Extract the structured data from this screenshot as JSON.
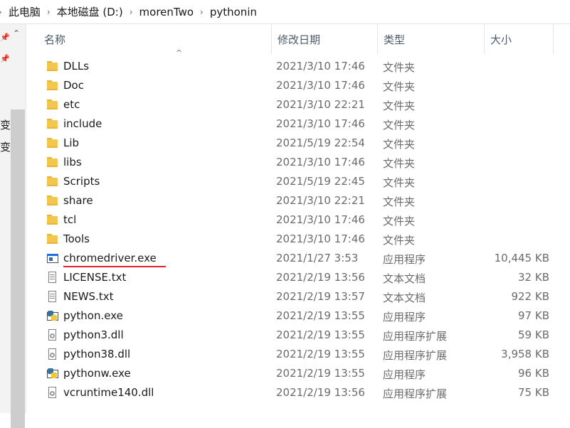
{
  "breadcrumb": [
    "此电脑",
    "本地磁盘 (D:)",
    "morenTwo",
    "pythonin"
  ],
  "nav": {
    "cut_labels": [
      "变",
      "变"
    ]
  },
  "columns": {
    "name": "名称",
    "date": "修改日期",
    "type": "类型",
    "size": "大小"
  },
  "files": [
    {
      "name": "DLLs",
      "date": "2021/3/10 17:46",
      "type": "文件夹",
      "size": "",
      "icon": "folder-icon"
    },
    {
      "name": "Doc",
      "date": "2021/3/10 17:46",
      "type": "文件夹",
      "size": "",
      "icon": "folder-icon"
    },
    {
      "name": "etc",
      "date": "2021/3/10 22:21",
      "type": "文件夹",
      "size": "",
      "icon": "folder-icon"
    },
    {
      "name": "include",
      "date": "2021/3/10 17:46",
      "type": "文件夹",
      "size": "",
      "icon": "folder-icon"
    },
    {
      "name": "Lib",
      "date": "2021/5/19 22:54",
      "type": "文件夹",
      "size": "",
      "icon": "folder-icon"
    },
    {
      "name": "libs",
      "date": "2021/3/10 17:46",
      "type": "文件夹",
      "size": "",
      "icon": "folder-icon"
    },
    {
      "name": "Scripts",
      "date": "2021/5/19 22:45",
      "type": "文件夹",
      "size": "",
      "icon": "folder-icon"
    },
    {
      "name": "share",
      "date": "2021/3/10 22:21",
      "type": "文件夹",
      "size": "",
      "icon": "folder-icon"
    },
    {
      "name": "tcl",
      "date": "2021/3/10 17:46",
      "type": "文件夹",
      "size": "",
      "icon": "folder-icon"
    },
    {
      "name": "Tools",
      "date": "2021/3/10 17:46",
      "type": "文件夹",
      "size": "",
      "icon": "folder-icon"
    },
    {
      "name": "chromedriver.exe",
      "date": "2021/1/27 3:53",
      "type": "应用程序",
      "size": "10,445 KB",
      "icon": "app-exe-icon",
      "underlined": true
    },
    {
      "name": "LICENSE.txt",
      "date": "2021/2/19 13:56",
      "type": "文本文档",
      "size": "32 KB",
      "icon": "text-file-icon"
    },
    {
      "name": "NEWS.txt",
      "date": "2021/2/19 13:57",
      "type": "文本文档",
      "size": "922 KB",
      "icon": "text-file-icon"
    },
    {
      "name": "python.exe",
      "date": "2021/2/19 13:55",
      "type": "应用程序",
      "size": "97 KB",
      "icon": "python-exe-icon"
    },
    {
      "name": "python3.dll",
      "date": "2021/2/19 13:55",
      "type": "应用程序扩展",
      "size": "59 KB",
      "icon": "dll-icon"
    },
    {
      "name": "python38.dll",
      "date": "2021/2/19 13:55",
      "type": "应用程序扩展",
      "size": "3,958 KB",
      "icon": "dll-icon"
    },
    {
      "name": "pythonw.exe",
      "date": "2021/2/19 13:55",
      "type": "应用程序",
      "size": "96 KB",
      "icon": "python-exe-icon"
    },
    {
      "name": "vcruntime140.dll",
      "date": "2021/2/19 13:56",
      "type": "应用程序扩展",
      "size": "75 KB",
      "icon": "dll-icon"
    }
  ],
  "colors": {
    "highlight_underline": "#e0242a",
    "folder": "#f3c74e"
  }
}
